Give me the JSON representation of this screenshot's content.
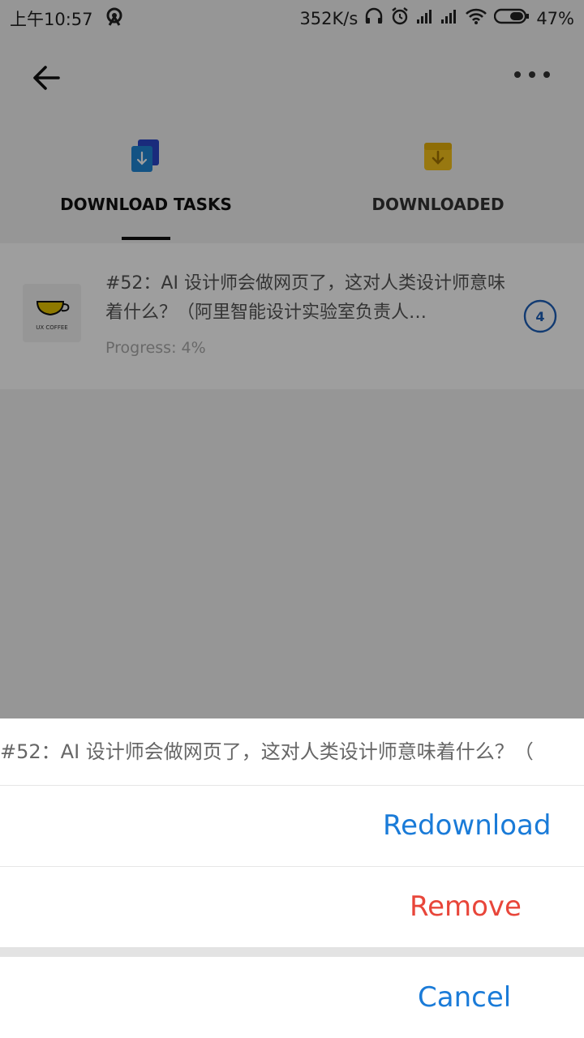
{
  "status_bar": {
    "time": "上午10:57",
    "net_speed": "352K/s",
    "battery": "47%"
  },
  "icons": {
    "back": "arrow-left-icon",
    "more": "more-dots-icon"
  },
  "tabs": [
    {
      "label": "DOWNLOAD TASKS",
      "icon": "download-tasks-icon",
      "active": true,
      "color": "#111111"
    },
    {
      "label": "DOWNLOADED",
      "icon": "downloaded-box-icon",
      "active": false,
      "color": "#333333"
    }
  ],
  "task": {
    "thumb_text": "UX COFFEE",
    "title": "#52：AI 设计师会做网页了，这对人类设计师意味着什么？（阿里智能设计实验室负责人…",
    "progress": "Progress: 4%",
    "progress_value": 4,
    "badge": "4"
  },
  "sheet": {
    "title": "#52：AI 设计师会做网页了，这对人类设计师意味着什么？（",
    "items": [
      {
        "label": "Redownload",
        "color": "#1a7bd8"
      },
      {
        "label": "Remove",
        "color": "#e8463a"
      }
    ],
    "cancel": {
      "label": "Cancel",
      "color": "#1a7bd8"
    }
  }
}
